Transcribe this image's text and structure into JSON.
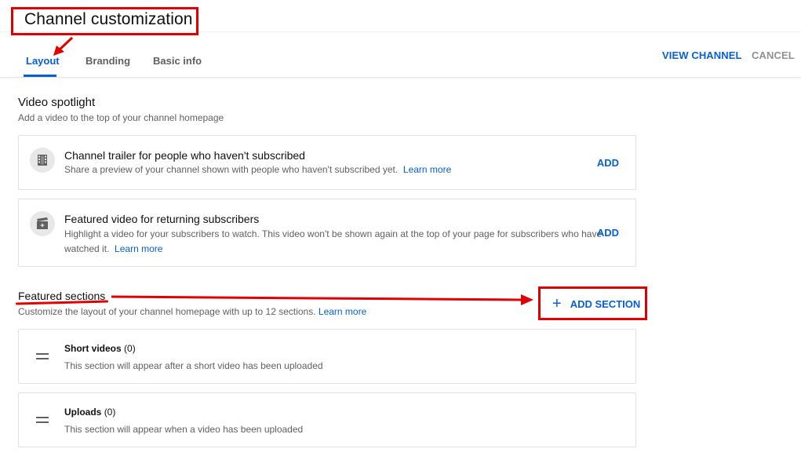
{
  "header": {
    "title": "Channel customization",
    "tabs": [
      {
        "label": "Layout",
        "active": true
      },
      {
        "label": "Branding",
        "active": false
      },
      {
        "label": "Basic info",
        "active": false
      }
    ],
    "view_channel_label": "VIEW CHANNEL",
    "cancel_label": "CANCEL"
  },
  "spotlight": {
    "title": "Video spotlight",
    "subtitle": "Add a video to the top of your channel homepage",
    "cards": [
      {
        "icon": "film-icon",
        "title": "Channel trailer for people who haven't subscribed",
        "desc": "Share a preview of your channel shown with people who haven't subscribed yet.",
        "link": "Learn more",
        "add_label": "ADD"
      },
      {
        "icon": "sparkle-clapper-icon",
        "title": "Featured video for returning subscribers",
        "desc_line1": "Highlight a video for your subscribers to watch. This video won't be shown again at the top of your page for subscribers who have",
        "desc_line2": "watched it.",
        "link": "Learn more",
        "add_label": "ADD"
      }
    ]
  },
  "featured": {
    "title": "Featured sections",
    "subtitle": "Customize the layout of your channel homepage with up to 12 sections.",
    "link": "Learn more",
    "add_section_label": "ADD SECTION",
    "sections": [
      {
        "name": "Short videos",
        "count": "(0)",
        "desc": "This section will appear after a short video has been uploaded"
      },
      {
        "name": "Uploads",
        "count": "(0)",
        "desc": "This section will appear when a video has been uploaded"
      }
    ]
  },
  "colors": {
    "accent": "#065fd4",
    "annotation": "#e00000",
    "muted": "#606060"
  }
}
